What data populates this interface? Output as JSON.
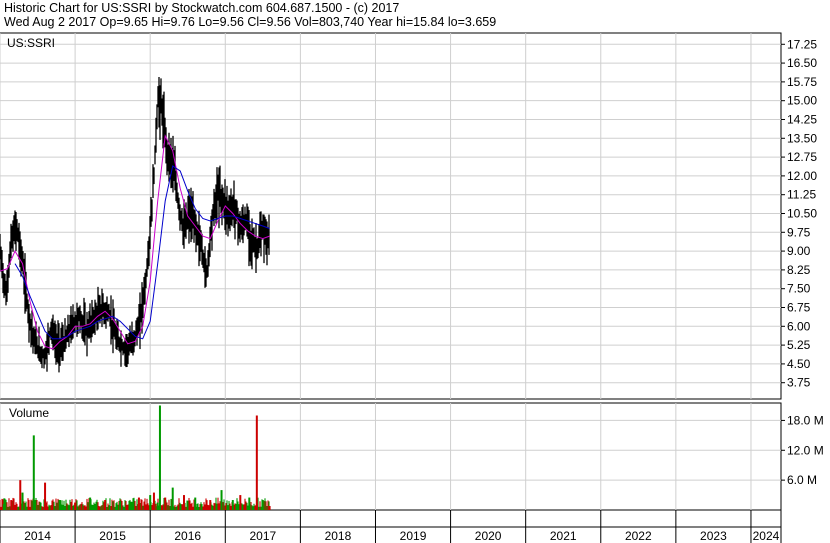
{
  "header": {
    "line1": "Historic Chart for US:SSRI by Stockwatch.com 604.687.1500 - (c) 2017",
    "line2": "Wed Aug  2 2017  Op=9.65  Hi=9.76  Lo=9.56  Cl=9.56  Vol=803,740  Year hi=15.84  lo=3.659"
  },
  "chart_data": {
    "type": "line",
    "price_panel_label": "US:SSRI",
    "volume_panel_label": "Volume",
    "x_axis": {
      "tick_labels": [
        "2014",
        "2015",
        "2016",
        "2017",
        "2018",
        "2019",
        "2020",
        "2021",
        "2022",
        "2023",
        "2024"
      ],
      "range": [
        2014.0,
        2024.4
      ]
    },
    "price_axis": {
      "tick_labels": [
        "17.25",
        "16.50",
        "15.75",
        "15.00",
        "14.25",
        "13.50",
        "12.75",
        "12.00",
        "11.25",
        "10.50",
        "9.75",
        "9.00",
        "8.25",
        "7.50",
        "6.75",
        "6.00",
        "5.25",
        "4.50",
        "3.75"
      ],
      "range": [
        3.1,
        17.7
      ]
    },
    "volume_axis": {
      "tick_labels": [
        "18.0 M",
        "12.0 M",
        "6.0 M"
      ],
      "range": [
        0,
        21.5
      ]
    },
    "grid": true,
    "series": [
      {
        "kind": "price-bars",
        "color": "#000000",
        "x": [
          2014.0,
          2014.08,
          2014.15,
          2014.22,
          2014.3,
          2014.38,
          2014.45,
          2014.52,
          2014.6,
          2014.68,
          2014.75,
          2014.85,
          2014.95,
          2015.05,
          2015.15,
          2015.25,
          2015.35,
          2015.45,
          2015.55,
          2015.65,
          2015.75,
          2015.85,
          2015.95,
          2016.0,
          2016.05,
          2016.1,
          2016.15,
          2016.22,
          2016.3,
          2016.38,
          2016.45,
          2016.52,
          2016.6,
          2016.68,
          2016.75,
          2016.82,
          2016.9,
          2016.97,
          2017.05,
          2017.12,
          2017.2,
          2017.28,
          2017.35,
          2017.42,
          2017.5,
          2017.55,
          2017.59
        ],
        "values": [
          9.0,
          7.2,
          9.4,
          10.0,
          8.5,
          6.5,
          5.5,
          5.0,
          4.8,
          6.0,
          5.2,
          5.3,
          6.0,
          6.4,
          5.8,
          6.3,
          6.7,
          6.5,
          5.5,
          5.1,
          5.3,
          6.0,
          8.0,
          9.8,
          12.0,
          15.0,
          14.8,
          13.0,
          12.5,
          10.8,
          9.8,
          10.5,
          10.0,
          9.2,
          8.0,
          10.2,
          11.4,
          11.0,
          10.5,
          10.8,
          9.9,
          10.2,
          9.4,
          9.1,
          9.8,
          9.5,
          9.56
        ]
      },
      {
        "kind": "moving-average",
        "color": "#cc00cc",
        "x": [
          2014.0,
          2014.1,
          2014.2,
          2014.3,
          2014.4,
          2014.5,
          2014.6,
          2014.7,
          2014.8,
          2014.9,
          2015.0,
          2015.1,
          2015.2,
          2015.3,
          2015.4,
          2015.5,
          2015.6,
          2015.7,
          2015.8,
          2015.9,
          2016.0,
          2016.1,
          2016.2,
          2016.3,
          2016.4,
          2016.5,
          2016.6,
          2016.7,
          2016.8,
          2016.9,
          2017.0,
          2017.1,
          2017.2,
          2017.3,
          2017.4,
          2017.5,
          2017.59
        ],
        "values": [
          8.2,
          8.3,
          9.0,
          8.5,
          7.0,
          5.8,
          5.2,
          5.1,
          5.4,
          5.6,
          6.0,
          6.0,
          6.1,
          6.4,
          6.6,
          6.3,
          5.8,
          5.3,
          5.4,
          6.0,
          7.8,
          11.0,
          13.6,
          13.0,
          11.5,
          10.4,
          10.0,
          9.6,
          9.5,
          10.2,
          10.8,
          10.5,
          10.1,
          9.8,
          9.6,
          9.5,
          9.6
        ]
      },
      {
        "kind": "moving-average",
        "color": "#0000cc",
        "x": [
          2014.2,
          2014.3,
          2014.4,
          2014.5,
          2014.6,
          2014.7,
          2014.8,
          2014.9,
          2015.0,
          2015.1,
          2015.2,
          2015.3,
          2015.4,
          2015.5,
          2015.6,
          2015.7,
          2015.8,
          2015.9,
          2016.0,
          2016.1,
          2016.2,
          2016.3,
          2016.4,
          2016.5,
          2016.6,
          2016.7,
          2016.8,
          2016.9,
          2017.0,
          2017.1,
          2017.2,
          2017.3,
          2017.4,
          2017.5,
          2017.59
        ],
        "values": [
          8.5,
          8.0,
          7.2,
          6.5,
          5.8,
          5.5,
          5.5,
          5.6,
          5.8,
          5.9,
          6.0,
          6.2,
          6.3,
          6.4,
          6.2,
          5.9,
          5.6,
          5.5,
          6.2,
          8.5,
          11.0,
          12.4,
          12.2,
          11.4,
          10.7,
          10.3,
          10.2,
          10.3,
          10.4,
          10.4,
          10.3,
          10.2,
          10.1,
          10.0,
          9.9
        ]
      },
      {
        "kind": "volume",
        "up_color": "#009900",
        "down_color": "#cc0000",
        "x": [
          2014.05,
          2014.15,
          2014.27,
          2014.3,
          2014.45,
          2014.6,
          2014.8,
          2015.0,
          2015.2,
          2015.4,
          2015.6,
          2015.85,
          2016.0,
          2016.05,
          2016.1,
          2016.13,
          2016.2,
          2016.3,
          2016.45,
          2016.6,
          2016.8,
          2016.95,
          2017.1,
          2017.2,
          2017.32,
          2017.42,
          2017.5,
          2017.59
        ],
        "values": [
          1.2,
          2.0,
          6.0,
          3.5,
          15.0,
          5.5,
          2.0,
          1.5,
          2.5,
          2.0,
          1.8,
          2.5,
          3.0,
          3.5,
          1.5,
          21.0,
          2.5,
          4.5,
          3.0,
          2.5,
          2.0,
          4.0,
          2.0,
          3.0,
          2.5,
          19.0,
          2.0,
          0.8
        ],
        "direction": [
          "up",
          "down",
          "down",
          "up",
          "up",
          "down",
          "up",
          "down",
          "up",
          "down",
          "up",
          "down",
          "up",
          "down",
          "up",
          "up",
          "down",
          "up",
          "down",
          "up",
          "down",
          "up",
          "up",
          "down",
          "up",
          "down",
          "up",
          "down"
        ]
      }
    ]
  }
}
